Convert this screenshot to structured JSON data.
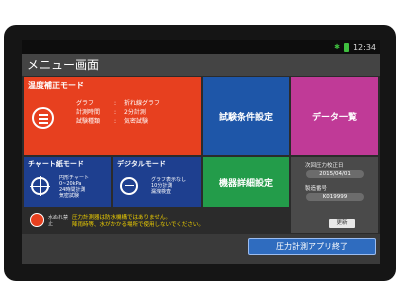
{
  "status": {
    "time": "12:34"
  },
  "window": {
    "title": "メニュー画面"
  },
  "temp_mode": {
    "title": "温度補正モード",
    "rows": [
      {
        "key": "グラフ",
        "value": "折れ線グラフ"
      },
      {
        "key": "計測時間",
        "value": "2分計測"
      },
      {
        "key": "試験種類",
        "value": "気密試験"
      }
    ]
  },
  "test_conditions": {
    "label": "試験条件設定"
  },
  "data_list": {
    "label": "データ一覧"
  },
  "chart_mode": {
    "title": "チャート紙モード",
    "lines": [
      "円形チャート",
      "0~20kPa",
      "24時間計測",
      "気密試験"
    ]
  },
  "digital_mode": {
    "title": "デジタルモード",
    "lines": [
      "グラフ表示なし",
      "10分計測",
      "漏洩検査"
    ]
  },
  "device_details": {
    "label": "機器詳細設定"
  },
  "device_info": {
    "calib_label": "次回圧力校正日",
    "calib_value": "2015/04/01",
    "serial_label": "製造番号",
    "serial_value": "K019999",
    "update_label": "更新"
  },
  "warning": {
    "icon_label": "水ぬれ禁止",
    "lines": [
      "圧力計測器は防水機構ではありません。",
      "降雨時等、水がかかる場所で使用しないでください。"
    ]
  },
  "footer": {
    "end_button": "圧力計測アプリ終了"
  }
}
